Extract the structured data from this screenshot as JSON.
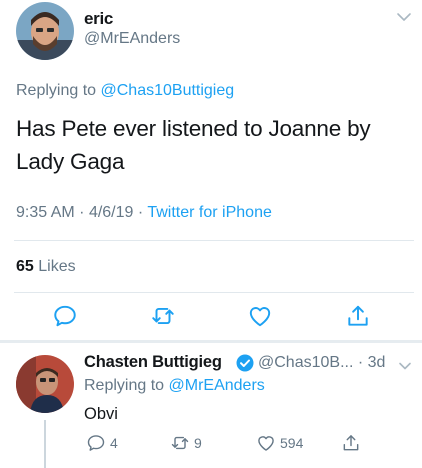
{
  "main_tweet": {
    "display_name": "eric",
    "handle": "@MrEAnders",
    "replying_prefix": "Replying to",
    "replying_to": "@Chas10Buttigieg",
    "text": "Has Pete ever listened to Joanne by Lady Gaga",
    "time": "9:35 AM",
    "date": "4/6/19",
    "source": "Twitter for iPhone",
    "likes_count": "65",
    "likes_label": "Likes",
    "actions": [
      "reply-icon",
      "retweet-icon",
      "like-icon",
      "share-icon"
    ]
  },
  "reply_tweet": {
    "display_name": "Chasten Buttigieg",
    "verified": true,
    "handle_time": "@Chas10B... · 3d",
    "replying_prefix": "Replying to",
    "replying_to": "@MrEAnders",
    "text": "Obvi",
    "reply_count": "4",
    "retweet_count": "9",
    "like_count": "594"
  },
  "colors": {
    "accent": "#1da1f2",
    "muted": "#657786",
    "text": "#14171a",
    "divider": "#e1e8ed"
  }
}
